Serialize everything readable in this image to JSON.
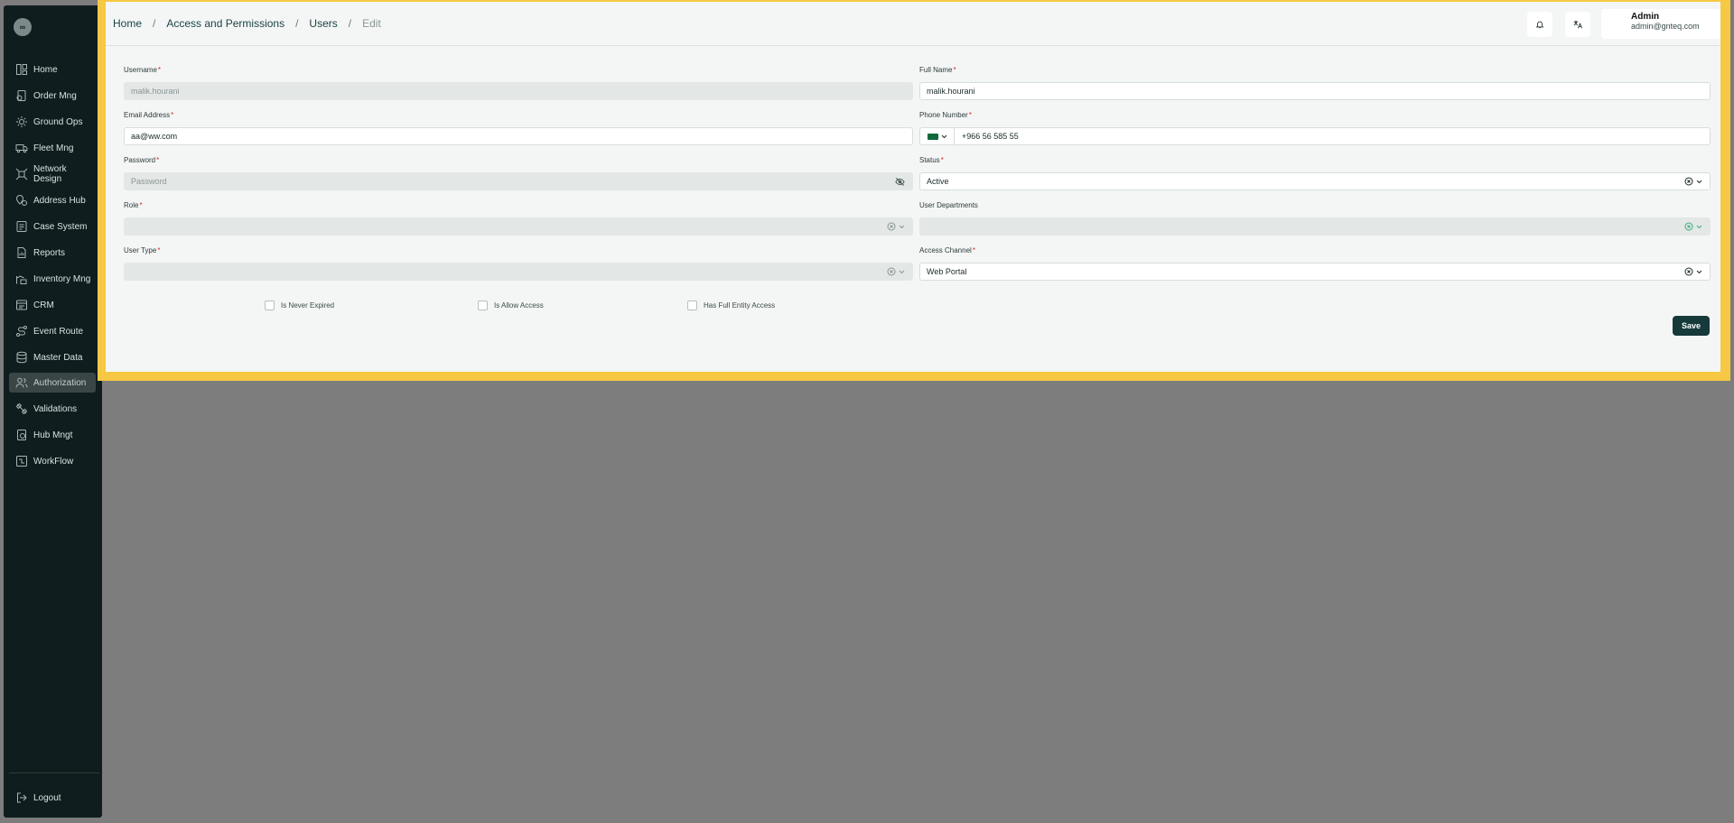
{
  "sidebar": {
    "logo_text": "∞",
    "items": [
      {
        "label": "Home",
        "icon": "home-icon"
      },
      {
        "label": "Order Mng",
        "icon": "order-icon"
      },
      {
        "label": "Ground Ops",
        "icon": "ground-ops-icon"
      },
      {
        "label": "Fleet Mng",
        "icon": "truck-icon"
      },
      {
        "label": "Network Design",
        "icon": "network-icon"
      },
      {
        "label": "Address Hub",
        "icon": "address-icon"
      },
      {
        "label": "Case System",
        "icon": "case-icon"
      },
      {
        "label": "Reports",
        "icon": "report-icon"
      },
      {
        "label": "Inventory Mng",
        "icon": "inventory-icon"
      },
      {
        "label": "CRM",
        "icon": "crm-icon"
      },
      {
        "label": "Event Route",
        "icon": "route-icon"
      },
      {
        "label": "Master Data",
        "icon": "database-icon"
      },
      {
        "label": "Authorization",
        "icon": "users-icon",
        "active": true
      },
      {
        "label": "Validations",
        "icon": "validation-icon"
      },
      {
        "label": "Hub Mngt",
        "icon": "hub-icon"
      },
      {
        "label": "WorkFlow",
        "icon": "workflow-icon"
      }
    ],
    "logout_label": "Logout"
  },
  "breadcrumb": {
    "items": [
      "Home",
      "Access and Permissions",
      "Users"
    ],
    "current": "Edit",
    "separator": "/"
  },
  "header": {
    "user_name": "Admin",
    "user_email": "admin@gnteq.com"
  },
  "form": {
    "username": {
      "label": "Username",
      "value": "malik.hourani"
    },
    "full_name": {
      "label": "Full Name",
      "value": "malik.hourani"
    },
    "email": {
      "label": "Email Address",
      "value": "aa@ww.com"
    },
    "phone": {
      "label": "Phone Number",
      "value": "+966 56 585 55"
    },
    "password": {
      "label": "Password",
      "placeholder": "Password"
    },
    "status": {
      "label": "Status",
      "value": "Active"
    },
    "role": {
      "label": "Role",
      "value": ""
    },
    "user_departments": {
      "label": "User Departments",
      "value": ""
    },
    "user_type": {
      "label": "User Type",
      "value": ""
    },
    "access_channel": {
      "label": "Access Channel",
      "value": "Web Portal"
    },
    "required_mark": "*",
    "checkboxes": {
      "never_expired": "Is Never Expired",
      "allow_access": "Is Allow Access",
      "full_entity": "Has Full Entity Access"
    },
    "save_label": "Save"
  },
  "colors": {
    "sidebar_bg": "#0f1d1e",
    "highlight_border": "#f6c843",
    "primary": "#16393a",
    "required": "#d62828"
  }
}
